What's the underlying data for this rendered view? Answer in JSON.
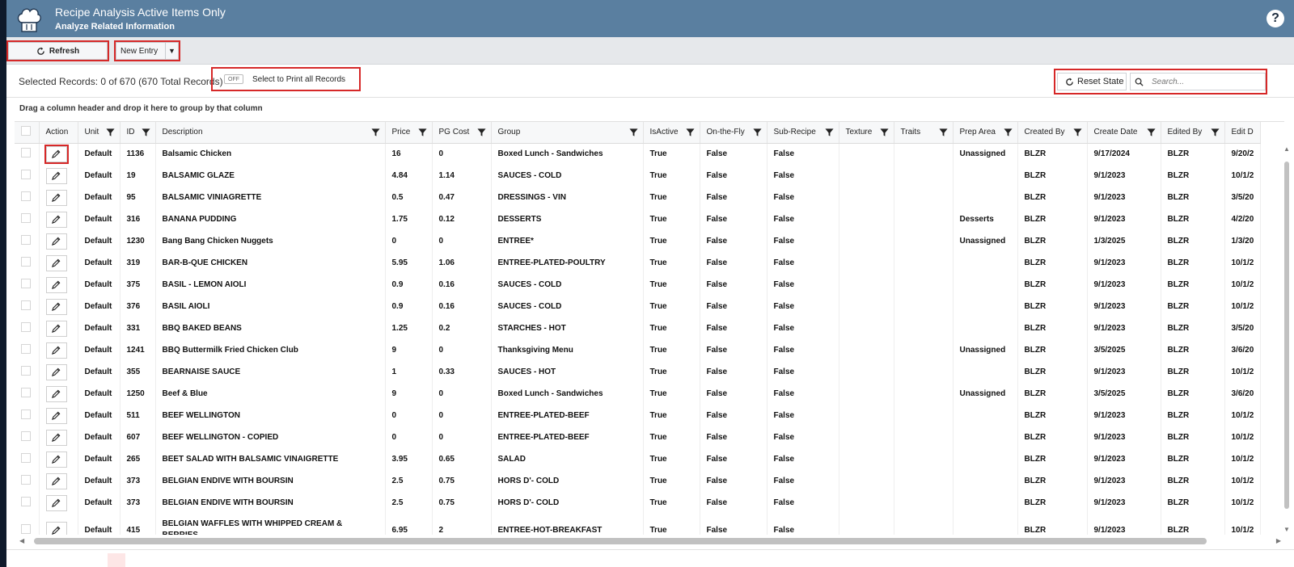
{
  "header": {
    "title": "Recipe Analysis Active Items Only",
    "subtitle": "Analyze Related Information",
    "help_icon": "?"
  },
  "toolbar": {
    "refresh_label": "Refresh",
    "new_entry_label": "New Entry"
  },
  "status": {
    "selected_records": "Selected Records: 0 of 670 (670 Total Records)",
    "toggle_state": "OFF",
    "print_all_label": "Select to Print all Records",
    "reset_label": "Reset State",
    "search_placeholder": "Search..."
  },
  "group_hint": "Drag a column header and drop it here to group by that column",
  "columns": {
    "action": "Action",
    "unit": "Unit",
    "id": "ID",
    "description": "Description",
    "price": "Price",
    "pg_cost": "PG Cost",
    "group": "Group",
    "is_active": "IsActive",
    "on_the_fly": "On-the-Fly",
    "sub_recipe": "Sub-Recipe",
    "texture": "Texture",
    "traits": "Traits",
    "prep_area": "Prep Area",
    "created_by": "Created By",
    "create_date": "Create Date",
    "edited_by": "Edited By",
    "edit_date": "Edit D"
  },
  "rows": [
    {
      "unit": "Default",
      "id": "1136",
      "description": "Balsamic Chicken",
      "price": "16",
      "pg_cost": "0",
      "group": "Boxed Lunch - Sandwiches",
      "is_active": "True",
      "on_the_fly": "False",
      "sub_recipe": "False",
      "texture": "",
      "traits": "",
      "prep_area": "Unassigned",
      "created_by": "BLZR",
      "create_date": "9/17/2024",
      "edited_by": "BLZR",
      "edit_date": "9/20/2"
    },
    {
      "unit": "Default",
      "id": "19",
      "description": "BALSAMIC GLAZE",
      "price": "4.84",
      "pg_cost": "1.14",
      "group": "SAUCES - COLD",
      "is_active": "True",
      "on_the_fly": "False",
      "sub_recipe": "False",
      "texture": "",
      "traits": "",
      "prep_area": "",
      "created_by": "BLZR",
      "create_date": "9/1/2023",
      "edited_by": "BLZR",
      "edit_date": "10/1/2"
    },
    {
      "unit": "Default",
      "id": "95",
      "description": "BALSAMIC VINIAGRETTE",
      "price": "0.5",
      "pg_cost": "0.47",
      "group": "DRESSINGS - VIN",
      "is_active": "True",
      "on_the_fly": "False",
      "sub_recipe": "False",
      "texture": "",
      "traits": "",
      "prep_area": "",
      "created_by": "BLZR",
      "create_date": "9/1/2023",
      "edited_by": "BLZR",
      "edit_date": "3/5/20"
    },
    {
      "unit": "Default",
      "id": "316",
      "description": "BANANA PUDDING",
      "price": "1.75",
      "pg_cost": "0.12",
      "group": "DESSERTS",
      "is_active": "True",
      "on_the_fly": "False",
      "sub_recipe": "False",
      "texture": "",
      "traits": "",
      "prep_area": "Desserts",
      "created_by": "BLZR",
      "create_date": "9/1/2023",
      "edited_by": "BLZR",
      "edit_date": "4/2/20"
    },
    {
      "unit": "Default",
      "id": "1230",
      "description": "Bang Bang Chicken Nuggets",
      "price": "0",
      "pg_cost": "0",
      "group": "ENTREE*",
      "is_active": "True",
      "on_the_fly": "False",
      "sub_recipe": "False",
      "texture": "",
      "traits": "",
      "prep_area": "Unassigned",
      "created_by": "BLZR",
      "create_date": "1/3/2025",
      "edited_by": "BLZR",
      "edit_date": "1/3/20"
    },
    {
      "unit": "Default",
      "id": "319",
      "description": "BAR-B-QUE CHICKEN",
      "price": "5.95",
      "pg_cost": "1.06",
      "group": "ENTREE-PLATED-POULTRY",
      "is_active": "True",
      "on_the_fly": "False",
      "sub_recipe": "False",
      "texture": "",
      "traits": "",
      "prep_area": "",
      "created_by": "BLZR",
      "create_date": "9/1/2023",
      "edited_by": "BLZR",
      "edit_date": "10/1/2"
    },
    {
      "unit": "Default",
      "id": "375",
      "description": "BASIL - LEMON AIOLI",
      "price": "0.9",
      "pg_cost": "0.16",
      "group": "SAUCES - COLD",
      "is_active": "True",
      "on_the_fly": "False",
      "sub_recipe": "False",
      "texture": "",
      "traits": "",
      "prep_area": "",
      "created_by": "BLZR",
      "create_date": "9/1/2023",
      "edited_by": "BLZR",
      "edit_date": "10/1/2"
    },
    {
      "unit": "Default",
      "id": "376",
      "description": "BASIL AIOLI",
      "price": "0.9",
      "pg_cost": "0.16",
      "group": "SAUCES - COLD",
      "is_active": "True",
      "on_the_fly": "False",
      "sub_recipe": "False",
      "texture": "",
      "traits": "",
      "prep_area": "",
      "created_by": "BLZR",
      "create_date": "9/1/2023",
      "edited_by": "BLZR",
      "edit_date": "10/1/2"
    },
    {
      "unit": "Default",
      "id": "331",
      "description": "BBQ BAKED BEANS",
      "price": "1.25",
      "pg_cost": "0.2",
      "group": "STARCHES - HOT",
      "is_active": "True",
      "on_the_fly": "False",
      "sub_recipe": "False",
      "texture": "",
      "traits": "",
      "prep_area": "",
      "created_by": "BLZR",
      "create_date": "9/1/2023",
      "edited_by": "BLZR",
      "edit_date": "3/5/20"
    },
    {
      "unit": "Default",
      "id": "1241",
      "description": "BBQ Buttermilk Fried Chicken Club",
      "price": "9",
      "pg_cost": "0",
      "group": "Thanksgiving Menu",
      "is_active": "True",
      "on_the_fly": "False",
      "sub_recipe": "False",
      "texture": "",
      "traits": "",
      "prep_area": "Unassigned",
      "created_by": "BLZR",
      "create_date": "3/5/2025",
      "edited_by": "BLZR",
      "edit_date": "3/6/20"
    },
    {
      "unit": "Default",
      "id": "355",
      "description": "BEARNAISE SAUCE",
      "price": "1",
      "pg_cost": "0.33",
      "group": "SAUCES - HOT",
      "is_active": "True",
      "on_the_fly": "False",
      "sub_recipe": "False",
      "texture": "",
      "traits": "",
      "prep_area": "",
      "created_by": "BLZR",
      "create_date": "9/1/2023",
      "edited_by": "BLZR",
      "edit_date": "10/1/2"
    },
    {
      "unit": "Default",
      "id": "1250",
      "description": "Beef & Blue",
      "price": "9",
      "pg_cost": "0",
      "group": "Boxed Lunch - Sandwiches",
      "is_active": "True",
      "on_the_fly": "False",
      "sub_recipe": "False",
      "texture": "",
      "traits": "",
      "prep_area": "Unassigned",
      "created_by": "BLZR",
      "create_date": "3/5/2025",
      "edited_by": "BLZR",
      "edit_date": "3/6/20"
    },
    {
      "unit": "Default",
      "id": "511",
      "description": "BEEF WELLINGTON",
      "price": "0",
      "pg_cost": "0",
      "group": "ENTREE-PLATED-BEEF",
      "is_active": "True",
      "on_the_fly": "False",
      "sub_recipe": "False",
      "texture": "",
      "traits": "",
      "prep_area": "",
      "created_by": "BLZR",
      "create_date": "9/1/2023",
      "edited_by": "BLZR",
      "edit_date": "10/1/2"
    },
    {
      "unit": "Default",
      "id": "607",
      "description": "BEEF WELLINGTON - COPIED",
      "price": "0",
      "pg_cost": "0",
      "group": "ENTREE-PLATED-BEEF",
      "is_active": "True",
      "on_the_fly": "False",
      "sub_recipe": "False",
      "texture": "",
      "traits": "",
      "prep_area": "",
      "created_by": "BLZR",
      "create_date": "9/1/2023",
      "edited_by": "BLZR",
      "edit_date": "10/1/2"
    },
    {
      "unit": "Default",
      "id": "265",
      "description": "BEET SALAD WITH BALSAMIC VINAIGRETTE",
      "price": "3.95",
      "pg_cost": "0.65",
      "group": "SALAD",
      "is_active": "True",
      "on_the_fly": "False",
      "sub_recipe": "False",
      "texture": "",
      "traits": "",
      "prep_area": "",
      "created_by": "BLZR",
      "create_date": "9/1/2023",
      "edited_by": "BLZR",
      "edit_date": "10/1/2"
    },
    {
      "unit": "Default",
      "id": "373",
      "description": "BELGIAN ENDIVE WITH BOURSIN",
      "price": "2.5",
      "pg_cost": "0.75",
      "group": "HORS D'- COLD",
      "is_active": "True",
      "on_the_fly": "False",
      "sub_recipe": "False",
      "texture": "",
      "traits": "",
      "prep_area": "",
      "created_by": "BLZR",
      "create_date": "9/1/2023",
      "edited_by": "BLZR",
      "edit_date": "10/1/2"
    },
    {
      "unit": "Default",
      "id": "373",
      "description": "BELGIAN ENDIVE WITH BOURSIN",
      "price": "2.5",
      "pg_cost": "0.75",
      "group": "HORS D'- COLD",
      "is_active": "True",
      "on_the_fly": "False",
      "sub_recipe": "False",
      "texture": "",
      "traits": "",
      "prep_area": "",
      "created_by": "BLZR",
      "create_date": "9/1/2023",
      "edited_by": "BLZR",
      "edit_date": "10/1/2"
    },
    {
      "unit": "Default",
      "id": "415",
      "description": "BELGIAN WAFFLES WITH WHIPPED CREAM & BERRIES",
      "price": "6.95",
      "pg_cost": "2",
      "group": "ENTREE-HOT-BREAKFAST",
      "is_active": "True",
      "on_the_fly": "False",
      "sub_recipe": "False",
      "texture": "",
      "traits": "",
      "prep_area": "",
      "created_by": "BLZR",
      "create_date": "9/1/2023",
      "edited_by": "BLZR",
      "edit_date": "10/1/2"
    }
  ],
  "colors": {
    "header_bg": "#5a7fa0",
    "highlight": "#d62828",
    "toolbar_bg": "#e6e8eb"
  },
  "icons": [
    "chef-hat-icon",
    "help-icon",
    "refresh-icon",
    "chevron-down-icon",
    "search-icon",
    "filter-icon",
    "pencil-icon"
  ]
}
